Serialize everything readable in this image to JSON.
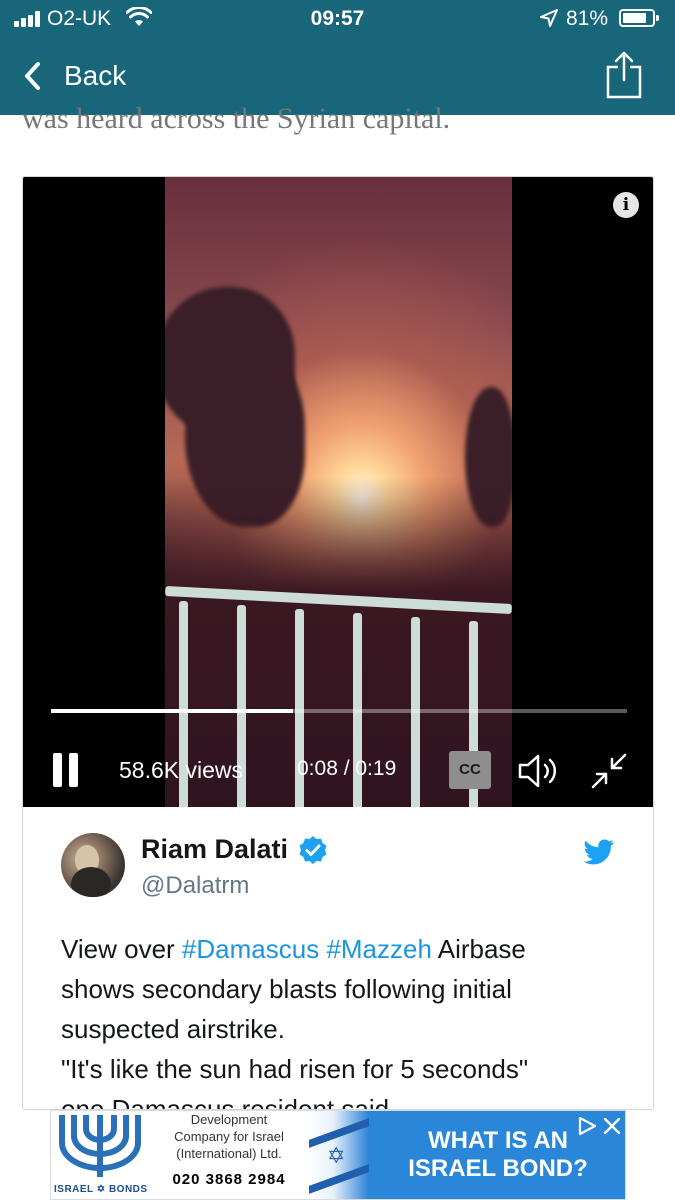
{
  "status_bar": {
    "carrier": "O2-UK",
    "time": "09:57",
    "battery": "81%",
    "battery_level": 0.81
  },
  "nav": {
    "back_label": "Back",
    "share_icon": "share-icon"
  },
  "article": {
    "peek_text": "was heard across the Syrian capital."
  },
  "video": {
    "views": "58.6K views",
    "time": "0:08 / 0:19",
    "cc_label": "CC",
    "progress_fraction": 0.42
  },
  "tweet": {
    "name": "Riam Dalati",
    "handle": "@Dalatrm",
    "lines": [
      {
        "pre": "View over ",
        "tags": [
          "#Damascus",
          "#Mazzeh"
        ],
        "post": " Airbase"
      },
      "shows secondary blasts following initial",
      "suspected airstrike.",
      "\"It's like the sun had risen for 5 seconds\"",
      "one Damascus resident said."
    ],
    "link_color": "#1b95e0"
  },
  "ad": {
    "company_line1": "Development",
    "company_line2": "Company for Israel",
    "company_line3": "(International) Ltd.",
    "phone": "020 3868 2984",
    "brand_left": "ISRAEL",
    "brand_right": "BONDS",
    "cta_line1": "WHAT IS AN",
    "cta_line2": "ISRAEL BOND?"
  },
  "colors": {
    "nav_bar": "#17667a",
    "verified": "#1da1f2",
    "ad_blue": "#2a86d8"
  }
}
